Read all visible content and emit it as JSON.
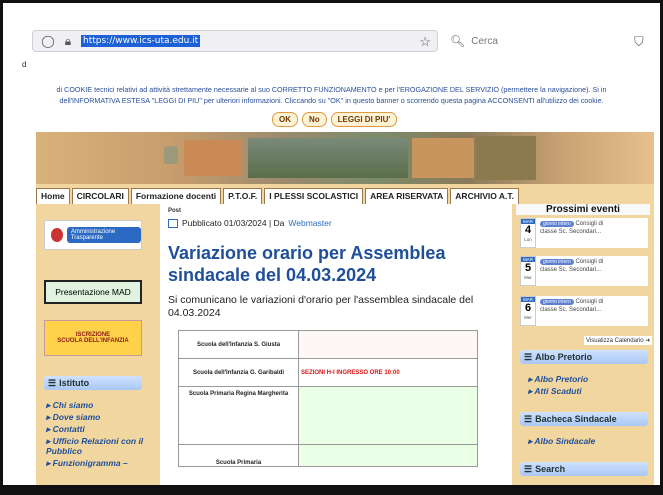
{
  "browser": {
    "url": "https://www.ics-uta.edu.it",
    "search_placeholder": "Cerca",
    "tiny_label": "d"
  },
  "cookie": {
    "line1": "di COOKIE tecnici relativi ad attività strettamente necessarie al suo CORRETTO FUNZIONAMENTO e per l'EROGAZIONE DEL SERVIZIO (permettere la navigazione). Si in",
    "line2": "dell'INFORMATIVA ESTESA \"LEGGI DI PIU\" per ulteriori informazioni. Cliccando su \"OK\" in questo banner o scorrendo questa pagina ACCONSENTI all'utilizzo dei cookie.",
    "ok": "OK",
    "no": "No",
    "more": "LEGGI DI PIU'"
  },
  "nav": [
    "Home",
    "CIRCOLARI",
    "Formazione docenti",
    "P.T.O.F.",
    "I PLESSI SCOLASTICI",
    "AREA RISERVATA",
    "ARCHIVIO A.T."
  ],
  "left": {
    "amministrazione": "Amministrazione Trasparente",
    "mad": "Presentazione MAD",
    "iscrizione_1": "ISCRIZIONE",
    "iscrizione_2": "SCUOLA DELL'INFANZIA",
    "istituto": "Istituto",
    "menu": [
      "Chi siamo",
      "Dove siamo",
      "Contatti",
      "Ufficio Relazioni con il Pubblico",
      "Funzionigramma –"
    ]
  },
  "post": {
    "tag": "Post",
    "meta_prefix": "Pubblicato 01/03/2024 | Da ",
    "author": "Webmaster",
    "title": "Variazione orario per Assemblea sindacale del 04.03.2024",
    "desc": "Si comunicano le variazioni d'orario per l'assemblea sindacale del 04.03.2024",
    "table": [
      {
        "school": "Scuola dell'Infanzia S. Giusta",
        "note": ""
      },
      {
        "school": "Scuola dell'Infanzia G. Garibaldi",
        "note": "SEZIONI H-I  INGRESSO ORE 10:00"
      },
      {
        "school": "Scuola Primaria Regina Margherita",
        "note": ""
      },
      {
        "school": "Scuola Primaria",
        "note": ""
      }
    ]
  },
  "right": {
    "events_title": "Prossimi eventi",
    "events": [
      {
        "month": "MAR",
        "day": "4",
        "weekday": "Lun",
        "pill": "giorno intero",
        "text1": "Consigli di",
        "text2": "classe Sc. Secondari..."
      },
      {
        "month": "MAR",
        "day": "5",
        "weekday": "Mar",
        "pill": "giorno intero",
        "text1": "Consigli di",
        "text2": "classe Sc. Secondari..."
      },
      {
        "month": "MAR",
        "day": "6",
        "weekday": "Mer",
        "pill": "giorno intero",
        "text1": "Consigli di",
        "text2": "classe Sc. Secondari..."
      }
    ],
    "calendar_link": "Visualizza Calendario",
    "albo": "Albo Pretorio",
    "albo_links": [
      "Albo Pretorio",
      "Atti Scaduti"
    ],
    "bacheca": "Bacheca Sindacale",
    "bacheca_links": [
      "Albo Sindacale"
    ],
    "search": "Search"
  }
}
